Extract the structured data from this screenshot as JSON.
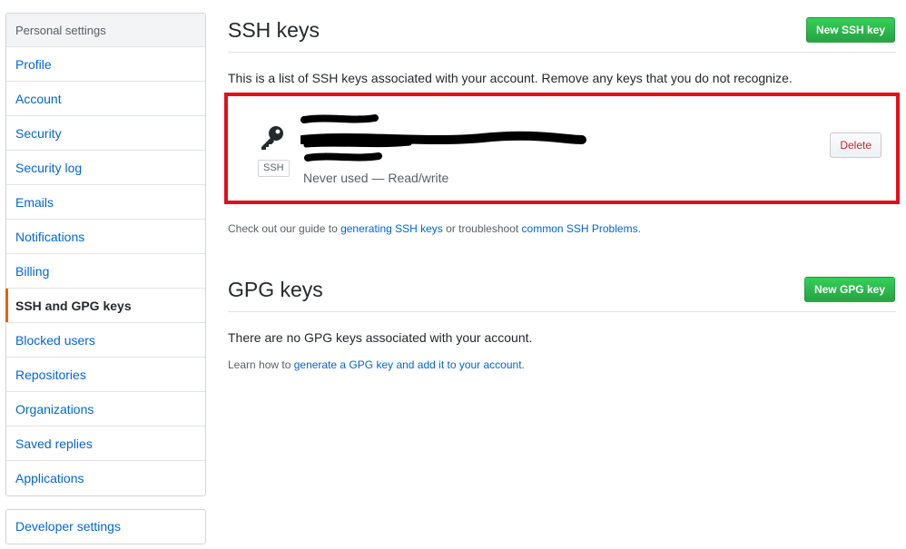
{
  "sidebar": {
    "header": "Personal settings",
    "items": [
      {
        "label": "Profile"
      },
      {
        "label": "Account"
      },
      {
        "label": "Security"
      },
      {
        "label": "Security log"
      },
      {
        "label": "Emails"
      },
      {
        "label": "Notifications"
      },
      {
        "label": "Billing"
      },
      {
        "label": "SSH and GPG keys",
        "selected": true
      },
      {
        "label": "Blocked users"
      },
      {
        "label": "Repositories"
      },
      {
        "label": "Organizations"
      },
      {
        "label": "Saved replies"
      },
      {
        "label": "Applications"
      }
    ],
    "developer": {
      "label": "Developer settings"
    }
  },
  "ssh": {
    "title": "SSH keys",
    "new_button": "New SSH key",
    "description": "This is a list of SSH keys associated with your account. Remove any keys that you do not recognize.",
    "key": {
      "icon": "key-icon",
      "badge": "SSH",
      "usage": "Never used — Read/write",
      "delete_label": "Delete"
    },
    "guide": {
      "prefix": "Check out our guide to ",
      "link1": "generating SSH keys",
      "middle": " or troubleshoot ",
      "link2": "common SSH Problems",
      "suffix": "."
    }
  },
  "gpg": {
    "title": "GPG keys",
    "new_button": "New GPG key",
    "empty_message": "There are no GPG keys associated with your account.",
    "learn": {
      "prefix": "Learn how to ",
      "link": "generate a GPG key and add it to your account",
      "suffix": "."
    }
  },
  "colors": {
    "link": "#0366d6",
    "selected_indicator": "#e36209",
    "highlight_border": "#e0101c",
    "green_button": "#28a745",
    "danger_text": "#cb2431"
  }
}
